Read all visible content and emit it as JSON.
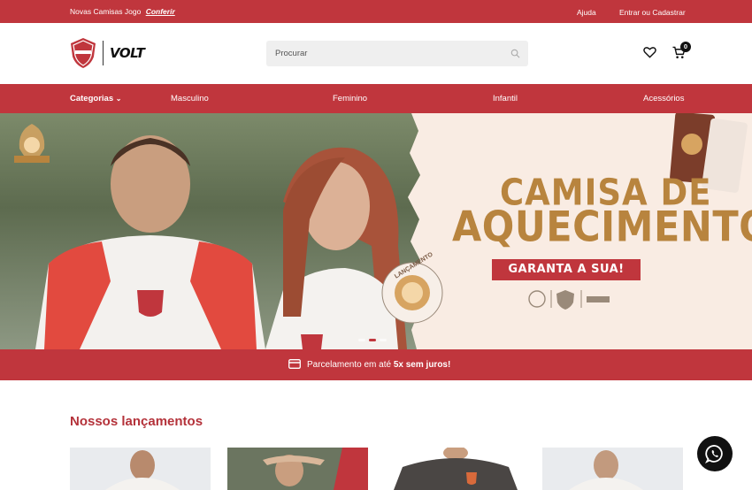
{
  "topbar": {
    "promo_text": "Novas Camisas Jogo",
    "promo_link": "Conferir",
    "help": "Ajuda",
    "login": "Entrar ou Cadastrar"
  },
  "header": {
    "brand": "VOLT",
    "search_placeholder": "Procurar",
    "cart_count": "0"
  },
  "nav": {
    "categories": "Categorias",
    "items": [
      "Masculino",
      "Feminino",
      "Infantil",
      "Acessórios"
    ]
  },
  "hero": {
    "title_line1": "CAMISA DE",
    "title_line2": "AQUECIMENTO!",
    "cta": "GARANTA A SUA!",
    "badge_text": "LANÇAMENTO",
    "slides": 3,
    "active_slide": 2
  },
  "installment": {
    "text": "Parcelamento em até",
    "bold": "5x sem juros!"
  },
  "launches": {
    "title": "Nossos lançamentos"
  },
  "colors": {
    "brand_red": "#c0363d",
    "title_gold": "#b8843e"
  }
}
